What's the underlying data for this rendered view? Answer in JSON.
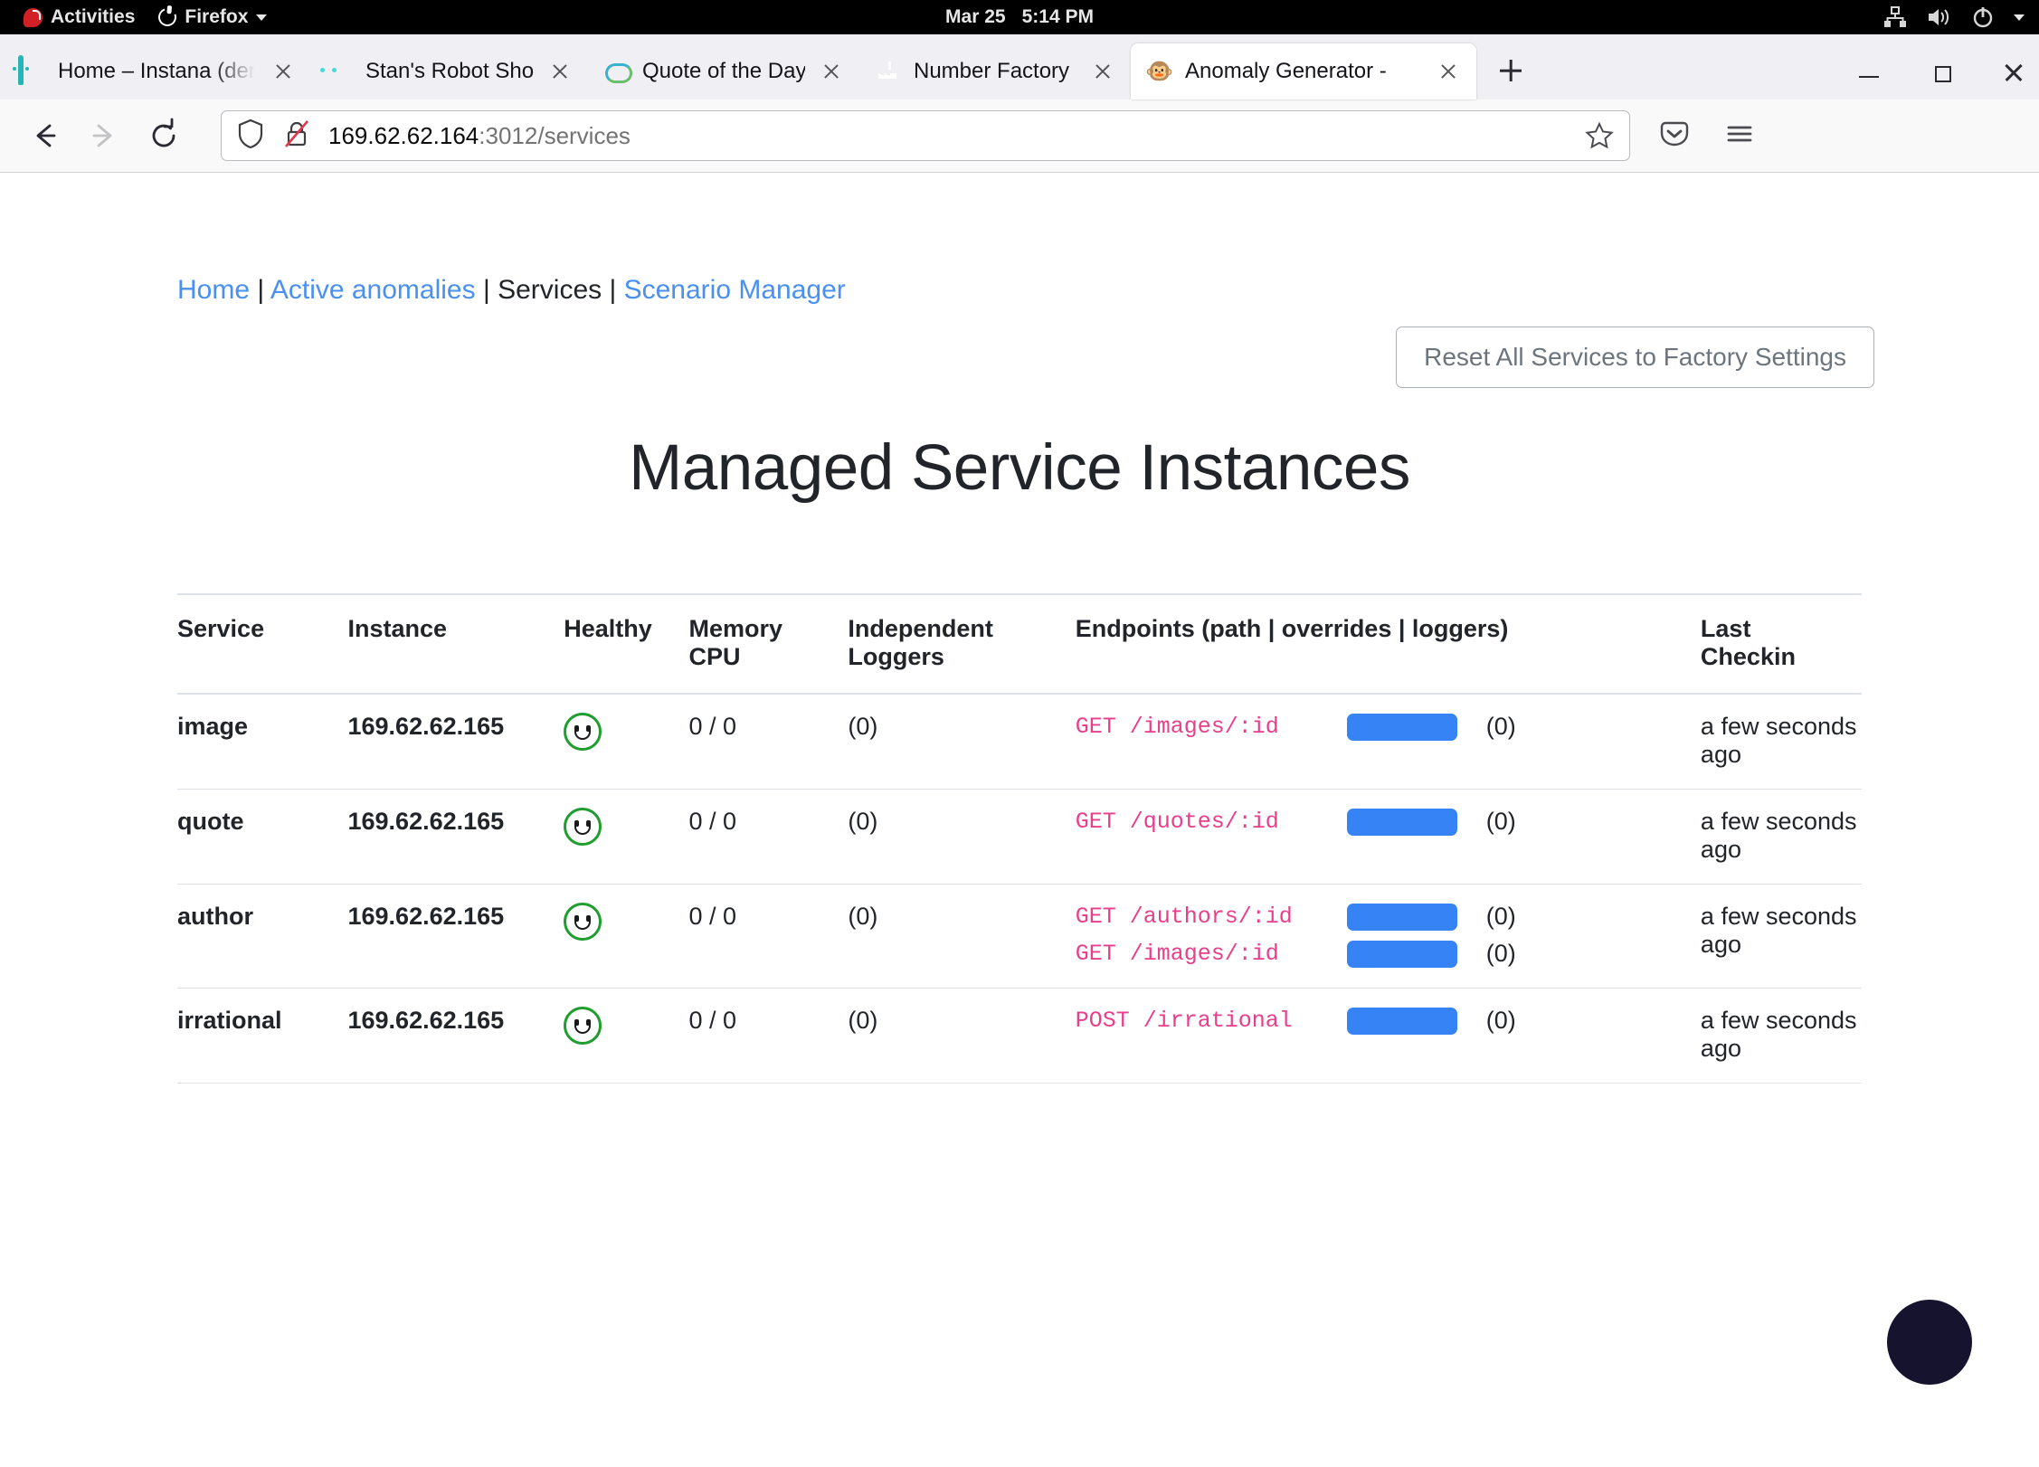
{
  "desktop": {
    "activities_label": "Activities",
    "app_menu_label": "Firefox",
    "clock_date": "Mar 25",
    "clock_time": "5:14 PM",
    "tray_icons": [
      "network-icon",
      "volume-icon",
      "power-icon",
      "chevron-down-icon"
    ]
  },
  "browser": {
    "tabs": [
      {
        "title": "Home – Instana (dem",
        "favicon": "instana-icon",
        "active": false
      },
      {
        "title": "Stan's Robot Shop",
        "favicon": "robot-icon",
        "active": false
      },
      {
        "title": "Quote of the Day",
        "favicon": "cloud-icon",
        "active": false
      },
      {
        "title": "Number Factory",
        "favicon": "factory-icon",
        "active": false
      },
      {
        "title": "Anomaly Generator -",
        "favicon": "monkey-icon",
        "active": true
      }
    ],
    "new_tab_label": "+",
    "url_host": "169.62.62.164",
    "url_path": ":3012/services",
    "window_controls": [
      "minimize",
      "maximize",
      "close"
    ]
  },
  "breadcrumb": {
    "items": [
      {
        "label": "Home",
        "current": false
      },
      {
        "label": "Active anomalies",
        "current": false
      },
      {
        "label": "Services",
        "current": true
      },
      {
        "label": "Scenario Manager",
        "current": false
      }
    ],
    "separator": "|"
  },
  "toolbar": {
    "reset_label": "Reset All Services to Factory Settings"
  },
  "page_title": "Managed Service Instances",
  "table": {
    "headers": {
      "service": "Service",
      "instance": "Instance",
      "healthy": "Healthy",
      "memory_cpu": "Memory\nCPU",
      "memory": "Memory",
      "cpu": "CPU",
      "independent": "Independent",
      "loggers": "Loggers",
      "endpoints": "Endpoints (path | overrides | loggers)",
      "last": "Last",
      "checkin": "Checkin"
    },
    "rows": [
      {
        "service": "image",
        "instance": "169.62.62.165",
        "healthy": "healthy-smiley-icon",
        "memory_cpu": "0 / 0",
        "independent_loggers": "(0)",
        "endpoints": [
          {
            "path": "GET /images/:id",
            "override_button": "override-pill",
            "loggers": "(0)"
          }
        ],
        "last_checkin": "a few seconds ago"
      },
      {
        "service": "quote",
        "instance": "169.62.62.165",
        "healthy": "healthy-smiley-icon",
        "memory_cpu": "0 / 0",
        "independent_loggers": "(0)",
        "endpoints": [
          {
            "path": "GET /quotes/:id",
            "override_button": "override-pill",
            "loggers": "(0)"
          }
        ],
        "last_checkin": "a few seconds ago"
      },
      {
        "service": "author",
        "instance": "169.62.62.165",
        "healthy": "healthy-smiley-icon",
        "memory_cpu": "0 / 0",
        "independent_loggers": "(0)",
        "endpoints": [
          {
            "path": "GET /authors/:id",
            "override_button": "override-pill",
            "loggers": "(0)"
          },
          {
            "path": "GET /images/:id",
            "override_button": "override-pill",
            "loggers": "(0)"
          }
        ],
        "last_checkin": "a few seconds ago"
      },
      {
        "service": "irrational",
        "instance": "169.62.62.165",
        "healthy": "healthy-smiley-icon",
        "memory_cpu": "0 / 0",
        "independent_loggers": "(0)",
        "endpoints": [
          {
            "path": "POST /irrational",
            "override_button": "override-pill",
            "loggers": "(0)"
          }
        ],
        "last_checkin": "a few seconds ago"
      }
    ]
  },
  "widget": {
    "chat_bubble": "chat-widget"
  },
  "colors": {
    "link": "#4a90f0",
    "endpoint_path": "#e83e8c",
    "override_pill": "#3583f5",
    "healthy": "#1f9d2f",
    "chat_bubble": "#15132e",
    "topbar": "#000000"
  }
}
